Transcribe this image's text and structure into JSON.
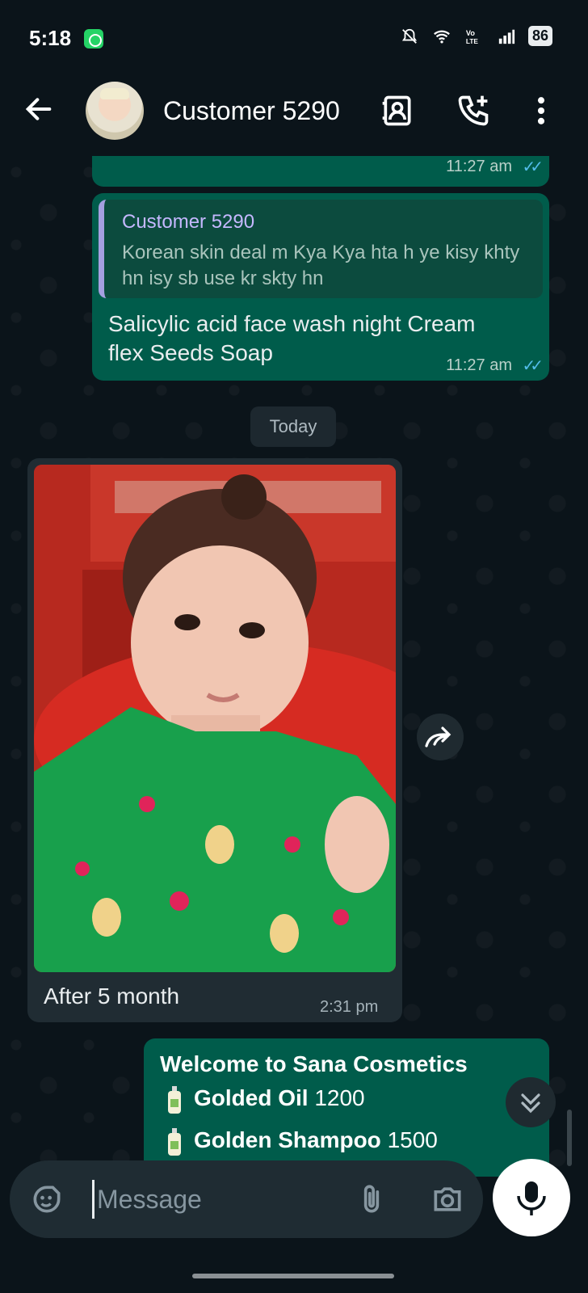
{
  "status_bar": {
    "time": "5:18",
    "battery": "86"
  },
  "header": {
    "contact_name": "Customer 5290"
  },
  "messages": [
    {
      "type": "outgoing",
      "time": "11:27 am"
    },
    {
      "type": "outgoing",
      "quote_name": "Customer 5290",
      "quote_text": "Korean skin deal m Kya Kya hta h ye kisy khty hn isy sb use kr skty hn",
      "text_line1": "Salicylic acid face wash night Cream",
      "text_line2": "flex Seeds Soap",
      "time": "11:27 am"
    },
    {
      "type": "date",
      "text": "Today"
    },
    {
      "type": "incoming-image",
      "caption": "After 5 month",
      "time": "2:31 pm"
    },
    {
      "type": "outgoing",
      "title": "Welcome to Sana Cosmetics",
      "items": [
        {
          "name": "Golded Oil",
          "price": "1200"
        },
        {
          "name": "Golden Shampoo",
          "price": "1500"
        }
      ]
    }
  ],
  "input": {
    "placeholder": "Message"
  },
  "colors": {
    "background": "#0b141a",
    "outgoing_bubble": "#005c4b",
    "incoming_bubble": "#202c33",
    "read_tick": "#53bdeb"
  }
}
